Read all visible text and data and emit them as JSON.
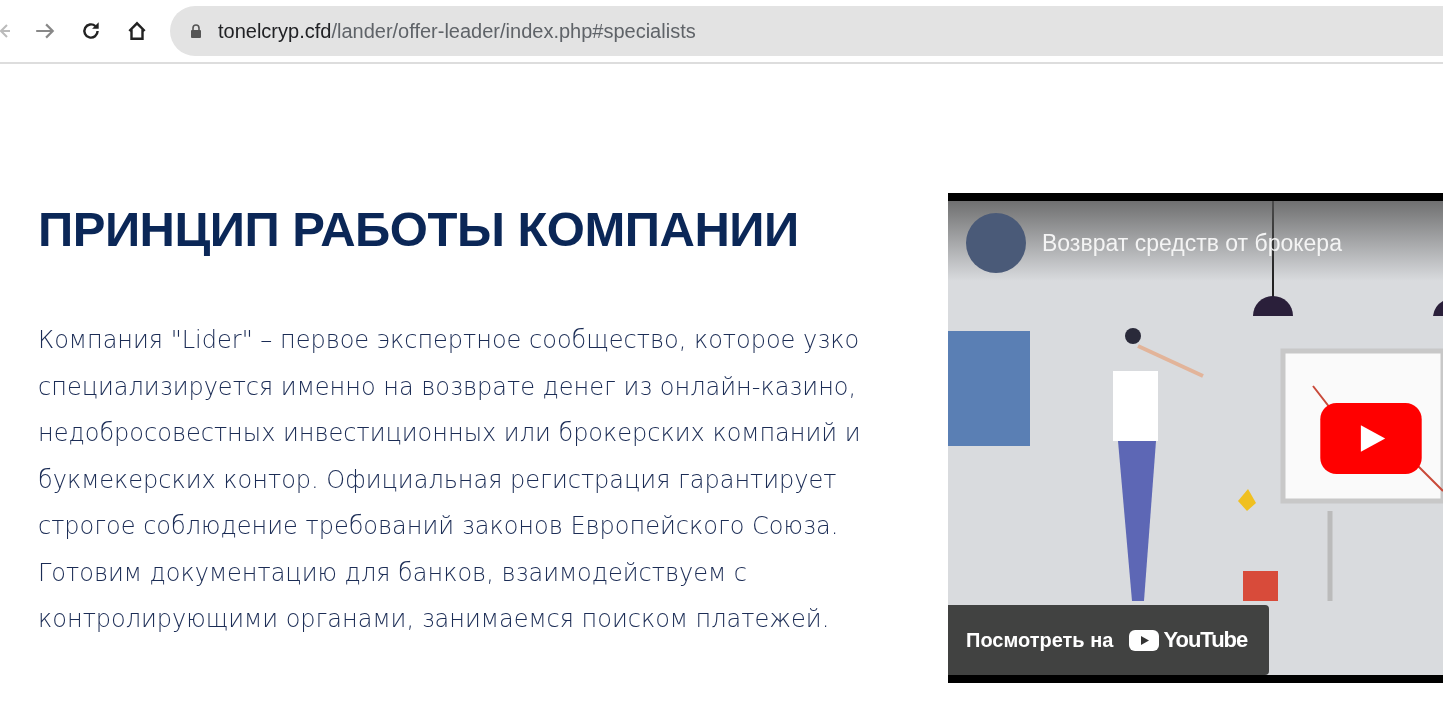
{
  "browser": {
    "url_host": "tonelcryp.cfd",
    "url_path": "/lander/offer-leader/index.php#specialists"
  },
  "section": {
    "heading": "ПРИНЦИП РАБОТЫ КОМПАНИИ",
    "paragraph": "Компания \"Lider\" – первое экспертное сообщество, которое узко специализируется именно на возврате денег из онлайн-казино, недобросовестных инвестиционных или брокерских компаний и букмекерских контор. Официальная регистрация гарантирует строгое соблюдение требований законов Европейского Союза. Готовим документацию для банков, взаимодействуем с контролирующими органами, занимаемся поиском платежей."
  },
  "video": {
    "title": "Возврат средств от брокера",
    "watch_label": "Посмотреть на",
    "watch_brand": "YouTube"
  }
}
